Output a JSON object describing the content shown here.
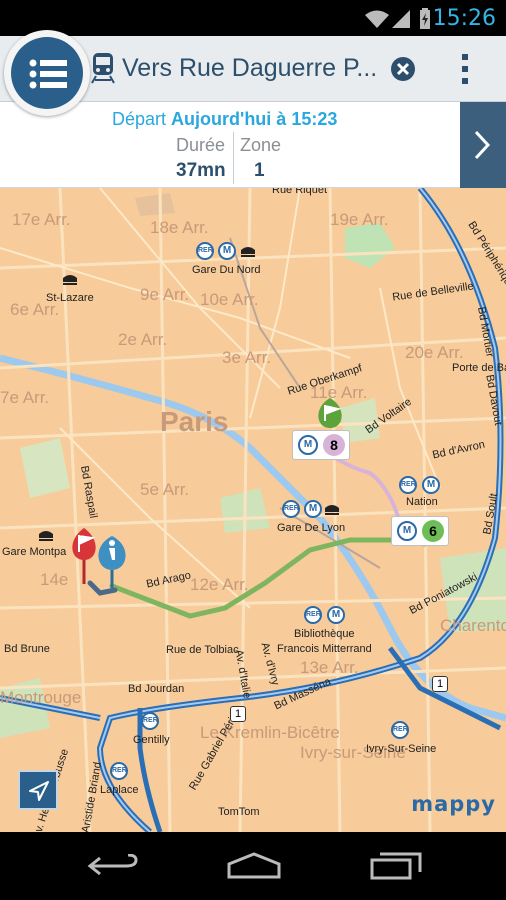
{
  "status_bar": {
    "time": "15:26"
  },
  "header": {
    "title": "Vers Rue Daguerre P..."
  },
  "trip": {
    "departure_label": "Départ",
    "departure_value": "Aujourd'hui à 15:23",
    "duration_label": "Durée",
    "duration_value": "37mn",
    "zone_label": "Zone",
    "zone_value": "1"
  },
  "map": {
    "city_label": "Paris",
    "place_labels": [
      "Gare Du Nord",
      "St-Lazare",
      "Gare De Lyon",
      "Nation",
      "Gare Montpa",
      "Bibliothèque",
      "Francois Mitterrand",
      "Gentilly",
      "Laplace",
      "Ivry-Sur-Seine",
      "TomTom",
      "Porte de Ba"
    ],
    "street_labels": [
      "Rue Riquet",
      "Rue de Belleville",
      "Rue Oberkampf",
      "Bd Raspail",
      "Bd Arago",
      "Rue de Tolbiac",
      "Av. d'Ivry",
      "Av. d'Italie",
      "Bd Masséna",
      "Bd Jourdan",
      "Bd Brune",
      "Rue Gabriel Péri",
      "Bd Voltaire",
      "Bd d'Avron",
      "Bd Soult",
      "Bd Poniatowski",
      "Bd Mortier",
      "Bd Davout",
      "Bd Périphérique",
      "Av. Henri Barbusse",
      "Av. Aristide Briand"
    ],
    "faint_labels": [
      "17e Arr.",
      "18e Arr.",
      "19e Arr.",
      "9e Arr.",
      "10e Arr.",
      "2e Arr.",
      "3e Arr.",
      "11e Arr.",
      "20e Arr.",
      "7e Arr.",
      "5e Arr.",
      "12e Arr.",
      "14e",
      "13e Arr.",
      "6e Arr.",
      "Charenton-le-Pont",
      "Montrouge",
      "Le Kremlin-Bicêtre",
      "Ivry-sur-Seine"
    ],
    "metro_lines": [
      "8",
      "6"
    ],
    "road_badges": [
      "1",
      "1"
    ],
    "rer_label": "RER",
    "metro_label": "M",
    "accent_color": "#29a7df",
    "route_color": "#7fb55e",
    "metro8_color": "#d8b3d8",
    "metro6_color": "#6fbd56"
  },
  "logo": {
    "text": "mappy"
  }
}
